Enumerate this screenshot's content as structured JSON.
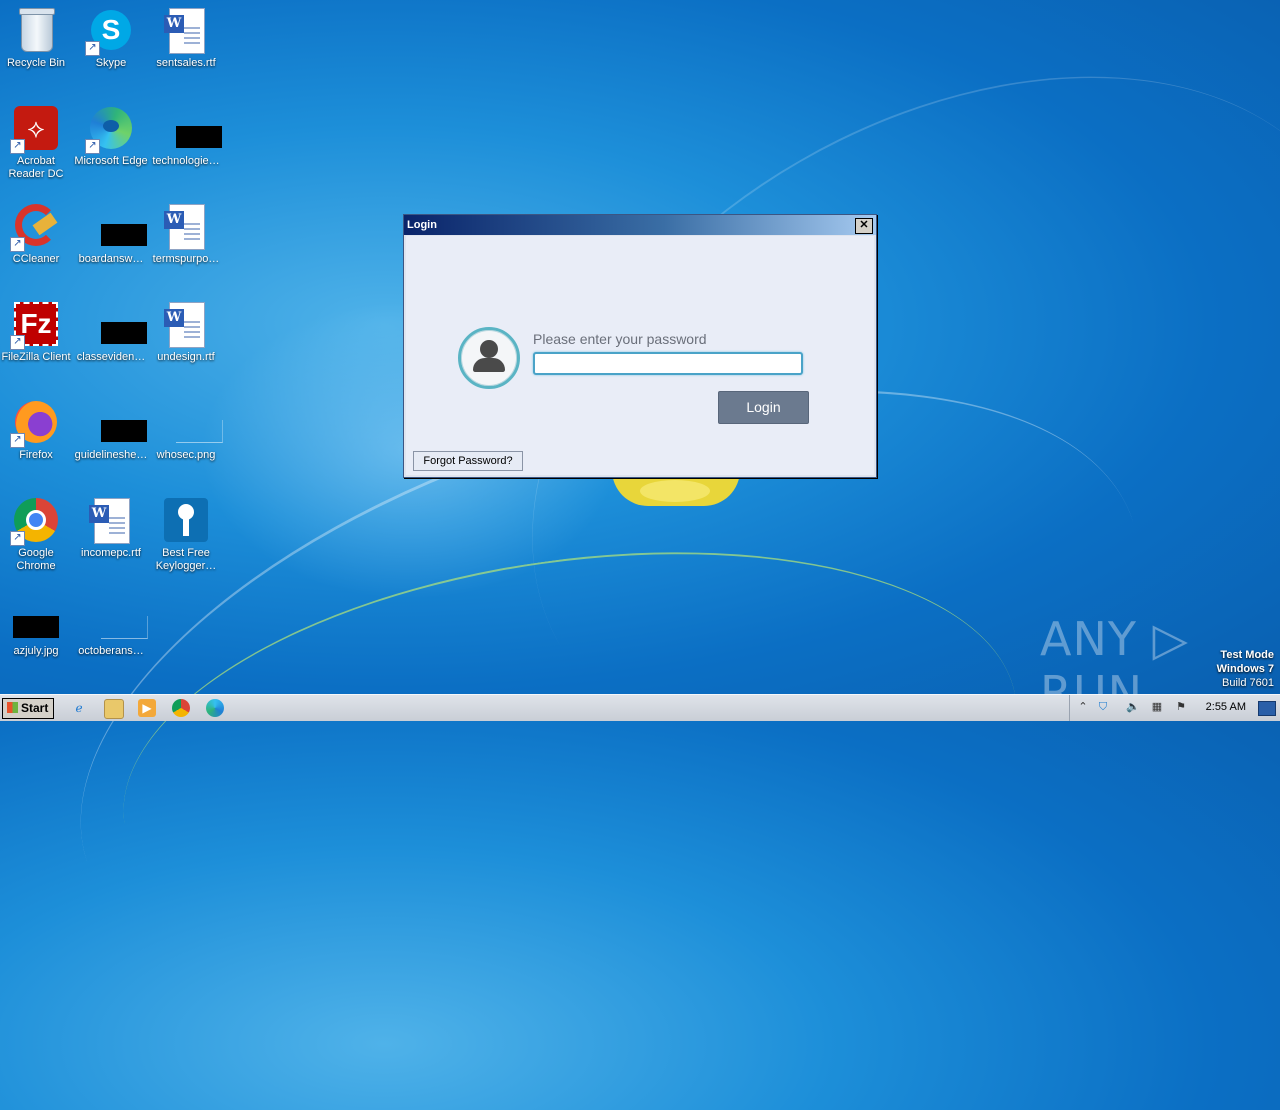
{
  "desktop": {
    "icons": [
      {
        "label": "Recycle Bin",
        "icon": "recycle-bin-icon"
      },
      {
        "label": "Skype",
        "icon": "skype-icon"
      },
      {
        "label": "sentsales.rtf",
        "icon": "word-document-icon"
      },
      {
        "label": "Acrobat Reader DC",
        "icon": "acrobat-icon"
      },
      {
        "label": "Microsoft Edge",
        "icon": "edge-icon"
      },
      {
        "label": "technologie…",
        "icon": "black-image-icon"
      },
      {
        "label": "CCleaner",
        "icon": "ccleaner-icon"
      },
      {
        "label": "boardansw…",
        "icon": "black-image-icon"
      },
      {
        "label": "termspurpo…",
        "icon": "word-document-icon"
      },
      {
        "label": "FileZilla Client",
        "icon": "filezilla-icon"
      },
      {
        "label": "classeviden…",
        "icon": "black-image-icon"
      },
      {
        "label": "undesign.rtf",
        "icon": "word-document-icon"
      },
      {
        "label": "Firefox",
        "icon": "firefox-icon"
      },
      {
        "label": "guidelineshe…",
        "icon": "black-image-icon"
      },
      {
        "label": "whosec.png",
        "icon": "image-file-icon"
      },
      {
        "label": "Google Chrome",
        "icon": "chrome-icon"
      },
      {
        "label": "incomepc.rtf",
        "icon": "word-document-icon"
      },
      {
        "label": "Best Free Keylogger…",
        "icon": "keylogger-icon"
      },
      {
        "label": "azjuly.jpg",
        "icon": "black-image-icon"
      },
      {
        "label": "octoberans…",
        "icon": "image-file-icon"
      }
    ]
  },
  "login_window": {
    "title": "Login",
    "close_symbol": "✕",
    "prompt": "Please enter your password",
    "password_value": "",
    "login_button": "Login",
    "forgot_button": "Forgot Password?"
  },
  "watermark": {
    "brand": "ANY ▷ RUN",
    "test_mode": "Test Mode",
    "os": "Windows 7",
    "build": "Build 7601"
  },
  "taskbar": {
    "start_label": "Start",
    "clock": "2:55 AM",
    "pinned": [
      "internet-explorer-icon",
      "file-explorer-icon",
      "media-player-icon",
      "chrome-icon",
      "edge-icon"
    ]
  }
}
